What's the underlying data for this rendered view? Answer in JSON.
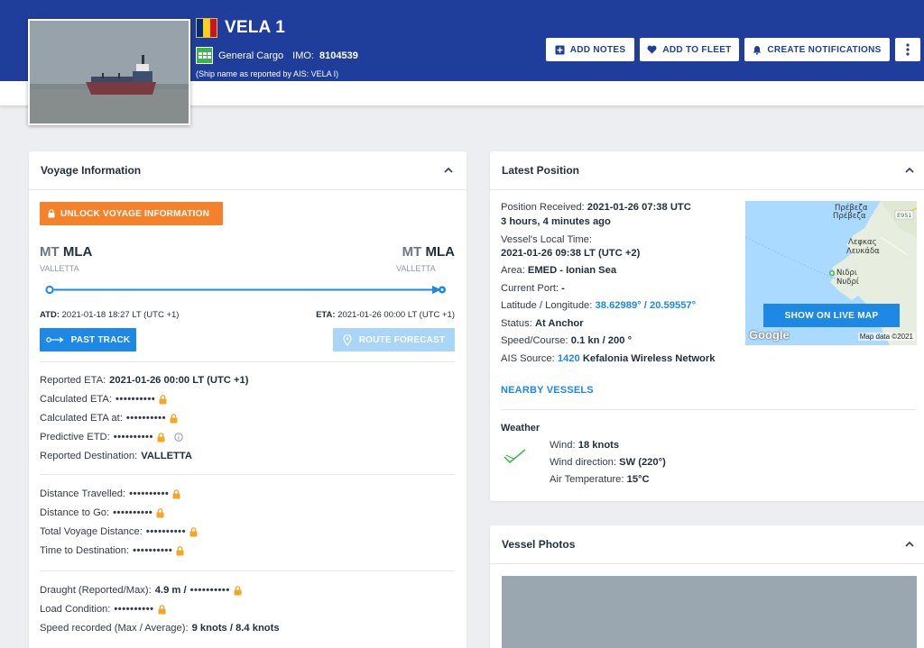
{
  "header": {
    "ship_name": "VELA 1",
    "vessel_type": "General Cargo",
    "imo_label": "IMO:",
    "imo_value": "8104539",
    "ais_name": "(Ship name as reported by AIS: VELA I)",
    "flag_colors": [
      "#002b7f",
      "#fcd116",
      "#ce1126"
    ],
    "buttons": {
      "add_notes": "ADD NOTES",
      "add_to_fleet": "ADD TO FLEET",
      "create_notifications": "CREATE NOTIFICATIONS"
    }
  },
  "voyage": {
    "title": "Voyage Information",
    "unlock_label": "UNLOCK VOYAGE INFORMATION",
    "departure": {
      "prefix": "MT",
      "code": "MLA",
      "name": "VALLETTA"
    },
    "arrival": {
      "prefix": "MT",
      "code": "MLA",
      "name": "VALLETTA"
    },
    "atd_label": "ATD:",
    "atd_value": "2021-01-18 18:27 LT (UTC +1)",
    "eta_label": "ETA:",
    "eta_value": "2021-01-26 00:00 LT (UTC +1)",
    "past_track_label": "PAST TRACK",
    "route_forecast_label": "ROUTE FORECAST",
    "masked": "••••••••••",
    "reported_eta_label": "Reported ETA:",
    "reported_eta_value": "2021-01-26 00:00 LT (UTC +1)",
    "calculated_eta_label": "Calculated ETA:",
    "calculated_eta_at_label": "Calculated ETA at:",
    "predictive_etd_label": "Predictive ETD:",
    "reported_destination_label": "Reported Destination:",
    "reported_destination_value": "VALLETTA",
    "distance_travelled_label": "Distance Travelled:",
    "distance_to_go_label": "Distance to Go:",
    "total_voyage_distance_label": "Total Voyage Distance:",
    "time_to_destination_label": "Time to Destination:",
    "draught_label": "Draught (Reported/Max):",
    "draught_value": "4.9 m /",
    "load_condition_label": "Load Condition:",
    "speed_recorded_label": "Speed recorded (Max / Average):",
    "speed_recorded_value": "9 knots / 8.4 knots"
  },
  "latest_position": {
    "title": "Latest Position",
    "position_received_label": "Position Received:",
    "position_received_value": "2021-01-26 07:38 UTC",
    "position_age": "3 hours, 4 minutes ago",
    "local_time_label": "Vessel's Local Time:",
    "local_time_value": "2021-01-26 09:38 LT (UTC +2)",
    "area_label": "Area:",
    "area_value": "EMED - Ionian Sea",
    "current_port_label": "Current Port:",
    "current_port_value": "-",
    "latlon_label": "Latitude / Longitude:",
    "latlon_value": "38.62989° / 20.59557°",
    "status_label": "Status:",
    "status_value": "At Anchor",
    "speed_course_label": "Speed/Course:",
    "speed_course_value": "0.1 kn / 200 °",
    "ais_source_label": "AIS Source:",
    "ais_source_id": "1420",
    "ais_source_name": "Kefalonia Wireless Network",
    "map": {
      "show_live_map": "SHOW ON LIVE MAP",
      "google": "Google",
      "map_data": "Map data ©2021",
      "place_1": "Πρέβεζα",
      "place_1b": "Πρέβεζα",
      "road": "E951",
      "place_2": "Λεφκας",
      "place_2b": "Λευκάδα",
      "place_3": "Νιδρι",
      "place_3b": "Νυδρί"
    },
    "nearby_vessels": "NEARBY VESSELS",
    "weather_title": "Weather",
    "wind_label": "Wind:",
    "wind_value": "18 knots",
    "wind_direction_label": "Wind direction:",
    "wind_direction_value": "SW (220°)",
    "air_temperature_label": "Air Temperature:",
    "air_temperature_value": "15°C"
  },
  "vessel_photos": {
    "title": "Vessel Photos"
  }
}
